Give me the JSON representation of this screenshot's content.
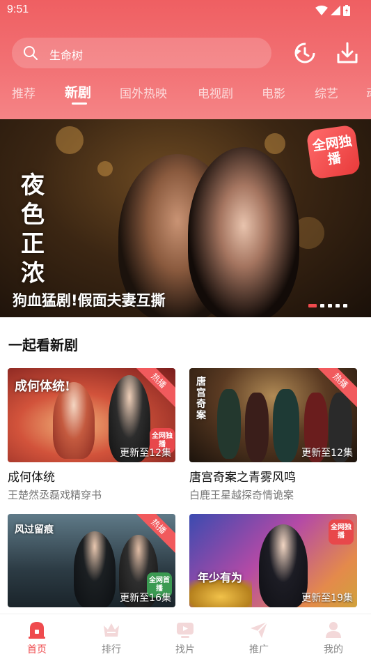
{
  "status_bar": {
    "time": "9:51"
  },
  "search": {
    "query": "生命树"
  },
  "tabs": [
    {
      "label": "推荐"
    },
    {
      "label": "新剧"
    },
    {
      "label": "国外热映"
    },
    {
      "label": "电视剧"
    },
    {
      "label": "电影"
    },
    {
      "label": "综艺"
    },
    {
      "label": "动"
    }
  ],
  "active_tab": "新剧",
  "banner": {
    "poster_title": "夜色正浓",
    "badge": "全网独播",
    "caption": "狗血猛剧!假面夫妻互撕",
    "slide_count": 5,
    "active_slide": 1
  },
  "section": {
    "title": "一起看新剧",
    "cards": [
      {
        "name": "成何体统",
        "desc": "王楚然丞磊戏精穿书",
        "episodes": "更新至12集",
        "corner": "热播",
        "thumb_title": "成何体统!",
        "has_badge": true
      },
      {
        "name": "唐宫奇案之青雾风鸣",
        "desc": "白鹿王星越探奇情诡案",
        "episodes": "更新至12集",
        "corner": "热播",
        "thumb_title": "唐宫奇案",
        "has_badge": false
      },
      {
        "name": "",
        "desc": "",
        "episodes": "更新至16集",
        "corner": "热播",
        "thumb_title": "风过留痕",
        "has_badge": true
      },
      {
        "name": "",
        "desc": "",
        "episodes": "更新至19集",
        "corner": "",
        "thumb_title": "年少有为",
        "has_badge": true
      }
    ]
  },
  "badge_text": {
    "exclusive": "全网独播",
    "first_run": "全网首播"
  },
  "bottom_nav": [
    {
      "label": "首页",
      "icon": "home-icon",
      "active": true
    },
    {
      "label": "排行",
      "icon": "crown-icon",
      "active": false
    },
    {
      "label": "找片",
      "icon": "tv-icon",
      "active": false
    },
    {
      "label": "推广",
      "icon": "send-icon",
      "active": false
    },
    {
      "label": "我的",
      "icon": "person-icon",
      "active": false
    }
  ],
  "colors": {
    "accent": "#ef4b4e",
    "header_top": "#ef5f62",
    "header_bottom": "#f58486"
  }
}
